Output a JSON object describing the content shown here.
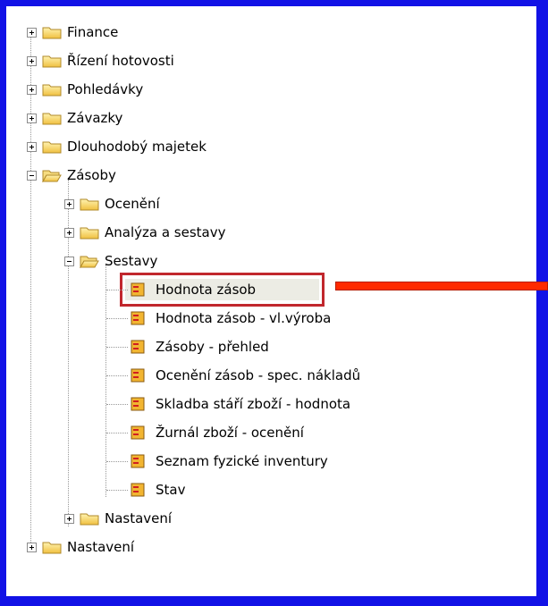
{
  "colors": {
    "background": "#1212e6",
    "highlight_border": "#c1272d",
    "arrow": "#ff2a00"
  },
  "tree": {
    "items": [
      {
        "label": "Finance",
        "state": "collapsed"
      },
      {
        "label": "Řízení hotovosti",
        "state": "collapsed"
      },
      {
        "label": "Pohledávky",
        "state": "collapsed"
      },
      {
        "label": "Závazky",
        "state": "collapsed"
      },
      {
        "label": "Dlouhodobý majetek",
        "state": "collapsed"
      },
      {
        "label": "Zásoby",
        "state": "expanded"
      },
      {
        "label": "Ocenění",
        "state": "collapsed"
      },
      {
        "label": "Analýza a sestavy",
        "state": "collapsed"
      },
      {
        "label": "Sestavy",
        "state": "expanded"
      },
      {
        "label": "Hodnota zásob",
        "state": "selected"
      },
      {
        "label": "Hodnota zásob - vl.výroba"
      },
      {
        "label": "Zásoby - přehled"
      },
      {
        "label": "Ocenění zásob - spec. nákladů"
      },
      {
        "label": "Skladba stáří zboží - hodnota"
      },
      {
        "label": "Žurnál zboží - ocenění"
      },
      {
        "label": "Seznam fyzické inventury"
      },
      {
        "label": "Stav"
      },
      {
        "label": "Nastavení",
        "state": "collapsed"
      },
      {
        "label": "Nastavení",
        "state": "collapsed"
      }
    ]
  }
}
